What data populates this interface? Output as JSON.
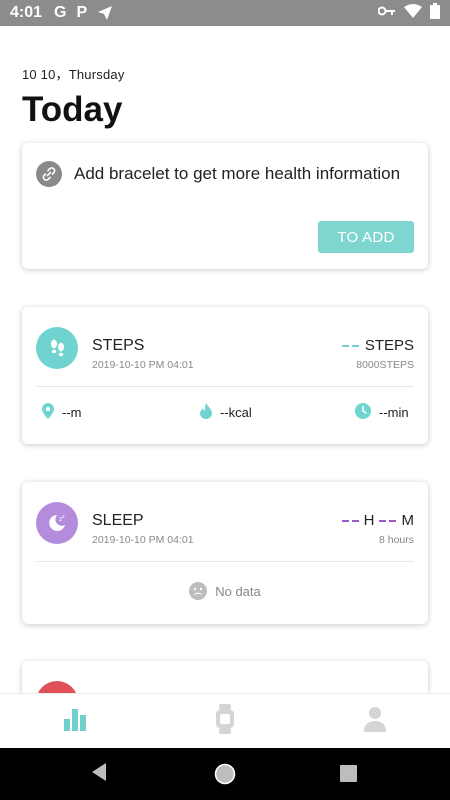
{
  "status_bar": {
    "time": "4:01",
    "icons": [
      "g-icon",
      "p-icon",
      "send-icon",
      "vpn-key-icon",
      "wifi-icon",
      "battery-icon"
    ],
    "g_label": "G",
    "p_label": "P"
  },
  "header": {
    "date": "10 10，Thursday",
    "title": "Today"
  },
  "bracelet_card": {
    "icon": "link-icon",
    "message": "Add bracelet to get more health information",
    "button_label": "TO ADD"
  },
  "steps_card": {
    "icon": "footprints-icon",
    "title": "STEPS",
    "date": "2019-10-10 PM 04:01",
    "value_label": "STEPS",
    "goal": "8000STEPS",
    "stats": [
      {
        "icon": "location-pin-icon",
        "value": "--m"
      },
      {
        "icon": "flame-icon",
        "value": "--kcal"
      },
      {
        "icon": "clock-icon",
        "value": "--min"
      }
    ]
  },
  "sleep_card": {
    "icon": "moon-icon",
    "title": "SLEEP",
    "date": "2019-10-10 PM 04:01",
    "hours_unit": "H",
    "minutes_unit": "M",
    "goal": "8 hours",
    "nodata_text": "No data"
  },
  "heart_card": {
    "icon": "heart-icon",
    "title": ""
  },
  "bottom_nav": {
    "items": [
      {
        "name": "stats-tab",
        "icon": "bar-chart-icon",
        "active": true
      },
      {
        "name": "device-tab",
        "icon": "watch-icon",
        "active": false
      },
      {
        "name": "profile-tab",
        "icon": "person-icon",
        "active": false
      }
    ]
  },
  "colors": {
    "accent_teal": "#7fd6d0",
    "steps_icon_bg": "#6fd3cf",
    "sleep_icon_bg": "#b38ddc",
    "sleep_dash": "#9b59c9",
    "heart_red": "#e05058",
    "nav_active": "#6fcfca",
    "nav_inactive": "#d5d5d5"
  }
}
